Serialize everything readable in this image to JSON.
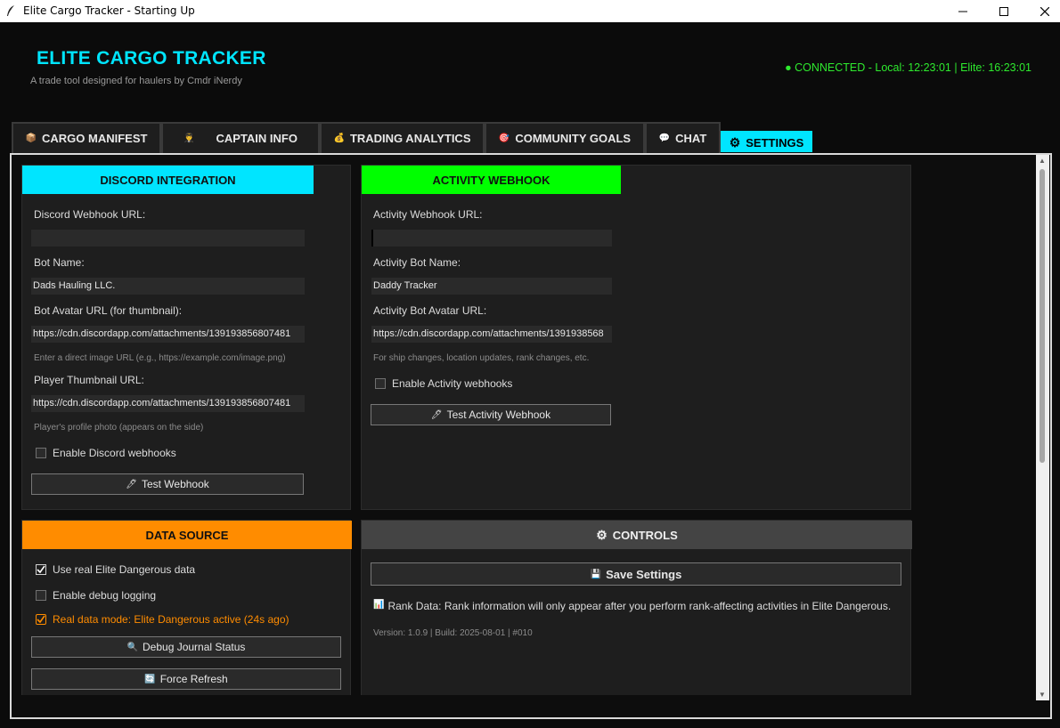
{
  "window": {
    "title": "Elite Cargo Tracker - Starting Up"
  },
  "header": {
    "title": "ELITE CARGO TRACKER",
    "subtitle": "A trade tool designed for haulers by Cmdr iNerdy",
    "status": "● CONNECTED - Local: 12:23:01 | Elite: 16:23:01"
  },
  "tabs": [
    {
      "icon": "📦",
      "label": "CARGO MANIFEST"
    },
    {
      "icon": "👨‍✈️",
      "label": "CAPTAIN INFO"
    },
    {
      "icon": "💰",
      "label": "TRADING ANALYTICS"
    },
    {
      "icon": "🎯",
      "label": "COMMUNITY GOALS"
    },
    {
      "icon": "💬",
      "label": "CHAT"
    },
    {
      "icon": "⚙",
      "label": "SETTINGS"
    }
  ],
  "discord": {
    "heading": "DISCORD INTEGRATION",
    "webhook_label": "Discord Webhook URL:",
    "webhook_value": "",
    "bot_name_label": "Bot Name:",
    "bot_name_value": "Dads Hauling LLC.",
    "avatar_label": "Bot Avatar URL (for thumbnail):",
    "avatar_value": "https://cdn.discordapp.com/attachments/139193856807481",
    "avatar_hint": "Enter a direct image URL (e.g., https://example.com/image.png)",
    "thumb_label": "Player Thumbnail URL:",
    "thumb_value": "https://cdn.discordapp.com/attachments/139193856807481",
    "thumb_hint": "Player's profile photo (appears on the side)",
    "enable_label": "Enable Discord webhooks",
    "test_button": "Test Webhook"
  },
  "activity": {
    "heading": "ACTIVITY WEBHOOK",
    "webhook_label": "Activity Webhook URL:",
    "webhook_value": "",
    "bot_name_label": "Activity Bot Name:",
    "bot_name_value": "Daddy Tracker",
    "avatar_label": "Activity Bot Avatar URL:",
    "avatar_value": "https://cdn.discordapp.com/attachments/1391938568",
    "hint": "For ship changes, location updates, rank changes, etc.",
    "enable_label": "Enable Activity webhooks",
    "test_button": "Test Activity Webhook"
  },
  "data_source": {
    "heading": "DATA SOURCE",
    "use_real_label": "Use real Elite Dangerous data",
    "use_real_checked": true,
    "debug_label": "Enable debug logging",
    "debug_checked": false,
    "status_text": "Real data mode: Elite Dangerous active (24s ago)",
    "debug_button": "Debug Journal Status",
    "refresh_button": "Force Refresh"
  },
  "controls": {
    "heading": "CONTROLS",
    "save_button": "Save Settings",
    "rank_note": "Rank Data: Rank information will only appear after you perform rank-affecting activities in Elite Dangerous.",
    "version": "Version: 1.0.9 | Build: 2025-08-01 | #010"
  },
  "colors": {
    "accent_cyan": "#00e5ff",
    "discord_head": "#00e5ff",
    "activity_head": "#00ff00",
    "data_source_head": "#ff8c00",
    "controls_head": "#444444",
    "status_green": "#2eea2e",
    "warning_orange": "#ff8c00"
  }
}
